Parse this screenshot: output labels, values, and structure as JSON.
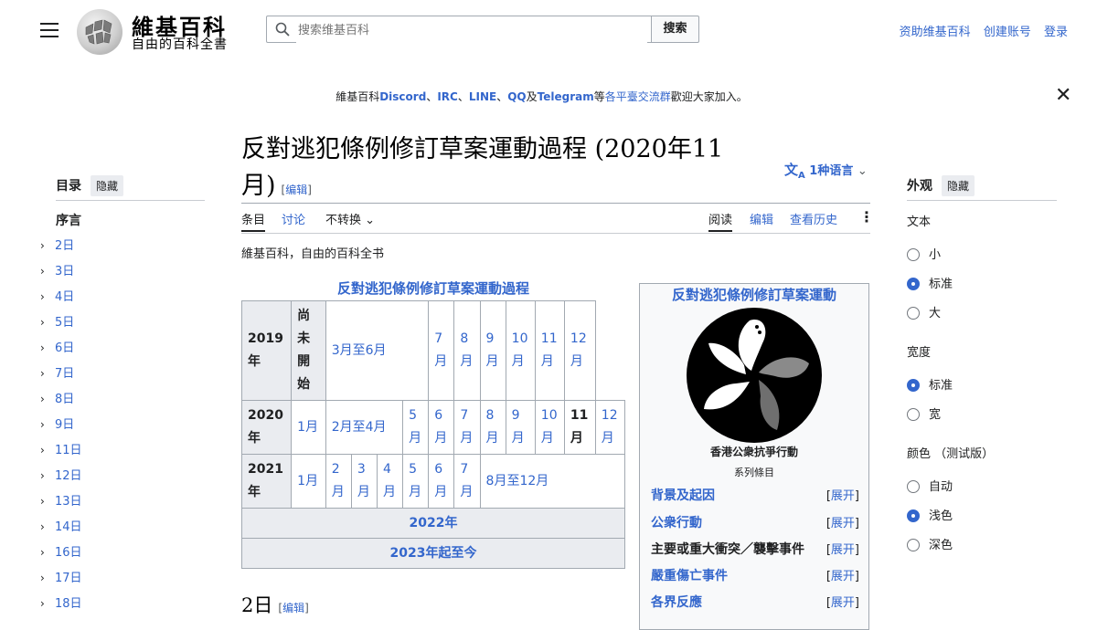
{
  "header": {
    "wordmark": "維基百科",
    "tagline": "自由的百科全書",
    "search_placeholder": "搜索维基百科",
    "search_button": "搜索",
    "user_links": [
      "资助维基百科",
      "创建账号",
      "登录"
    ]
  },
  "sitenotice": {
    "prefix": "維基百科",
    "links": [
      "Discord",
      "IRC",
      "LINE",
      "QQ",
      "Telegram"
    ],
    "sep1": "、",
    "mid": "及",
    "mid2": "等",
    "link2": "各平臺交流群",
    "suffix": "歡迎大家加入。"
  },
  "toc": {
    "title": "目录",
    "hide": "隐藏",
    "lead": "序言",
    "items": [
      "2日",
      "3日",
      "4日",
      "5日",
      "6日",
      "7日",
      "8日",
      "9日",
      "11日",
      "12日",
      "13日",
      "14日",
      "16日",
      "17日",
      "18日"
    ]
  },
  "page": {
    "title_line1": "反對逃犯條例修訂草案運動過程 (2020年11",
    "title_line2": "月)",
    "edit": "[编辑]",
    "languages": "1种语言",
    "tabs": {
      "article": "条目",
      "talk": "讨论",
      "variant": "不转换",
      "read": "阅读",
      "edit": "编辑",
      "history": "查看历史"
    },
    "site_sub": "維基百科，自由的百科全书",
    "section_heading": "2日"
  },
  "timeline": {
    "title": "反對逃犯條例修訂草案運動過程",
    "y2019": "2019年",
    "not_started": "尚未開始",
    "m3to6": "3月至6月",
    "y2020": "2020年",
    "m2to4": "2月至4月",
    "y2021": "2021年",
    "m8to12": "8月至12月",
    "months": {
      "m1": "1月",
      "m2": "2月",
      "m3": "3月",
      "m4": "4月",
      "m5": "5月",
      "m6": "6月",
      "m7": "7月",
      "m8": "8月",
      "m9": "9月",
      "m10": "10月",
      "m11": "11月",
      "m12": "12月"
    },
    "y2022": "2022年",
    "y2023": "2023年起至今"
  },
  "infobox": {
    "title": "反對逃犯條例修訂草案運動",
    "caption": "香港公衆抗爭行動",
    "subcaption": "系列條目",
    "rows": [
      {
        "label": "背景及起因",
        "link": true
      },
      {
        "label": "公衆行動",
        "link": true
      },
      {
        "label": "主要或重大衝突／襲擊事件",
        "link": false
      },
      {
        "label": "嚴重傷亡事件",
        "link": true
      },
      {
        "label": "各界反應",
        "link": true
      }
    ],
    "expand": "展开"
  },
  "appearance": {
    "title": "外观",
    "hide": "隐藏",
    "text_label": "文本",
    "text_options": [
      "小",
      "标准",
      "大"
    ],
    "width_label": "宽度",
    "width_options": [
      "标准",
      "宽"
    ],
    "color_label": "颜色 （测试版）",
    "color_options": [
      "自动",
      "浅色",
      "深色"
    ]
  },
  "colors": {
    "link": "#3366cc",
    "text": "#202122",
    "border": "#a2a9b1",
    "header_bg": "#eaecf0"
  }
}
